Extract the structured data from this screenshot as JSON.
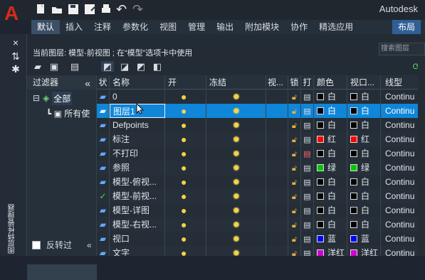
{
  "app": {
    "name": "Autodesk"
  },
  "ribbon": {
    "tabs": [
      "默认",
      "插入",
      "注释",
      "参数化",
      "视图",
      "管理",
      "输出",
      "附加模块",
      "协作",
      "精选应用",
      "布局"
    ]
  },
  "panel": {
    "current_layer": "当前图层: 模型-前视图 ; 在“模型”选项卡中使用",
    "search_placeholder": "搜索图层"
  },
  "filters": {
    "title": "过滤器",
    "all": "全部",
    "used": "所有使",
    "invert": "反转过"
  },
  "left_panel": {
    "vertical_label": "图层特性管理器"
  },
  "columns": [
    "状",
    "名称",
    "开",
    "冻结",
    "视...",
    "锁",
    "打",
    "颜色",
    "视口...",
    "线型"
  ],
  "rows": [
    {
      "status": "",
      "name": "0",
      "color": "白",
      "color_hex": "#000000",
      "vp_color": "白",
      "vp_color_hex": "#000000",
      "linetype": "Continu"
    },
    {
      "status": "",
      "name": "图层1",
      "color": "白",
      "color_hex": "#000000",
      "vp_color": "白",
      "vp_color_hex": "#000000",
      "linetype": "Continu"
    },
    {
      "status": "",
      "name": "Defpoints",
      "color": "白",
      "color_hex": "#000000",
      "vp_color": "白",
      "vp_color_hex": "#000000",
      "linetype": "Continu"
    },
    {
      "status": "",
      "name": "标注",
      "color": "红",
      "color_hex": "#ff0000",
      "vp_color": "红",
      "vp_color_hex": "#ff0000",
      "linetype": "Continu"
    },
    {
      "status": "",
      "name": "不打印",
      "color": "白",
      "color_hex": "#000000",
      "vp_color": "白",
      "vp_color_hex": "#000000",
      "linetype": "Continu"
    },
    {
      "status": "",
      "name": "参照",
      "color": "绿",
      "color_hex": "#00c800",
      "vp_color": "绿",
      "vp_color_hex": "#00c800",
      "linetype": "Continu"
    },
    {
      "status": "",
      "name": "模型-俯视...",
      "color": "白",
      "color_hex": "#000000",
      "vp_color": "白",
      "vp_color_hex": "#000000",
      "linetype": "Continu"
    },
    {
      "status": "✓",
      "name": "模型-前视...",
      "color": "白",
      "color_hex": "#000000",
      "vp_color": "白",
      "vp_color_hex": "#000000",
      "linetype": "Continu"
    },
    {
      "status": "",
      "name": "模型-详图",
      "color": "白",
      "color_hex": "#000000",
      "vp_color": "白",
      "vp_color_hex": "#000000",
      "linetype": "Continu"
    },
    {
      "status": "",
      "name": "模型-右视...",
      "color": "白",
      "color_hex": "#000000",
      "vp_color": "白",
      "vp_color_hex": "#000000",
      "linetype": "Continu"
    },
    {
      "status": "",
      "name": "视口",
      "color": "蓝",
      "color_hex": "#0000ff",
      "vp_color": "蓝",
      "vp_color_hex": "#0000ff",
      "linetype": "Continu"
    },
    {
      "status": "",
      "name": "文字",
      "color": "洋红",
      "color_hex": "#d000d0",
      "vp_color": "洋红",
      "vp_color_hex": "#d000d0",
      "linetype": "Continu"
    }
  ]
}
